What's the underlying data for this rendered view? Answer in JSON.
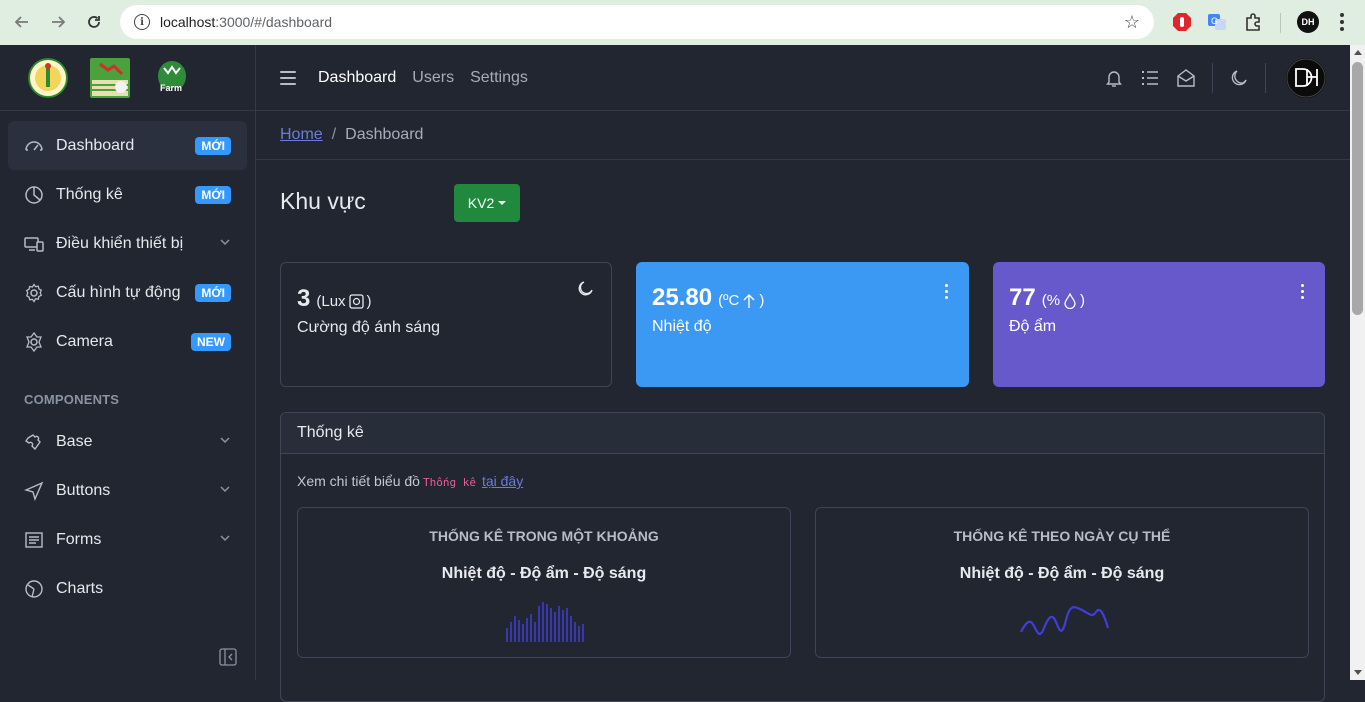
{
  "browser": {
    "url_host": "localhost",
    "url_rest": ":3000/#/dashboard"
  },
  "header": {
    "nav": [
      "Dashboard",
      "Users",
      "Settings"
    ],
    "avatar_text": "DH"
  },
  "sidebar": {
    "logos": [
      "school-logo",
      "agri-logo",
      "farm-logo"
    ],
    "farm_logo_text": "Farm",
    "items": [
      {
        "label": "Dashboard",
        "badge": "MỚI",
        "icon": "speedometer-icon"
      },
      {
        "label": "Thống kê",
        "badge": "MỚI",
        "icon": "chart-pie-icon"
      },
      {
        "label": "Điều khiển thiết bị",
        "badge": "",
        "icon": "devices-icon"
      },
      {
        "label": "Cấu hình tự động",
        "badge": "MỚI",
        "icon": "settings-icon"
      },
      {
        "label": "Camera",
        "badge": "NEW",
        "icon": "camera-icon"
      }
    ],
    "section_title": "COMPONENTS",
    "components": [
      {
        "label": "Base",
        "icon": "puzzle-icon"
      },
      {
        "label": "Buttons",
        "icon": "cursor-icon"
      },
      {
        "label": "Forms",
        "icon": "notes-icon"
      },
      {
        "label": "Charts",
        "icon": "chart-icon"
      }
    ]
  },
  "breadcrumb": {
    "home": "Home",
    "separator": "/",
    "current": "Dashboard"
  },
  "main": {
    "area_title": "Khu vực",
    "area_select": "KV2",
    "cards": [
      {
        "value": "3",
        "unit": "(Lux",
        "unit_close": ")",
        "desc": "Cường độ ánh sáng",
        "color": "#212631"
      },
      {
        "value": "25.80",
        "unit": "(ºC",
        "unit_close": ")",
        "desc": "Nhiệt độ",
        "color": "#3b99f4"
      },
      {
        "value": "77",
        "unit": "(%",
        "unit_close": ")",
        "desc": "Độ ẩm",
        "color": "#6759cb"
      }
    ],
    "stats": {
      "header": "Thống kê",
      "note_prefix": "Xem chi tiết biểu đồ",
      "note_code": "Thống kê",
      "note_link": "tại đây",
      "charts": [
        {
          "title": "THỐNG KÊ TRONG MỘT KHOẢNG",
          "subtitle": "Nhiệt độ - Độ ẩm - Độ sáng"
        },
        {
          "title": "THỐNG KÊ THEO NGÀY CỤ THỂ",
          "subtitle": "Nhiệt độ - Độ ẩm - Độ sáng"
        }
      ]
    }
  },
  "colors": {
    "accent_blue": "#3399ff",
    "kv_green": "#21893e",
    "chart_stroke": "#3f3fd8"
  }
}
